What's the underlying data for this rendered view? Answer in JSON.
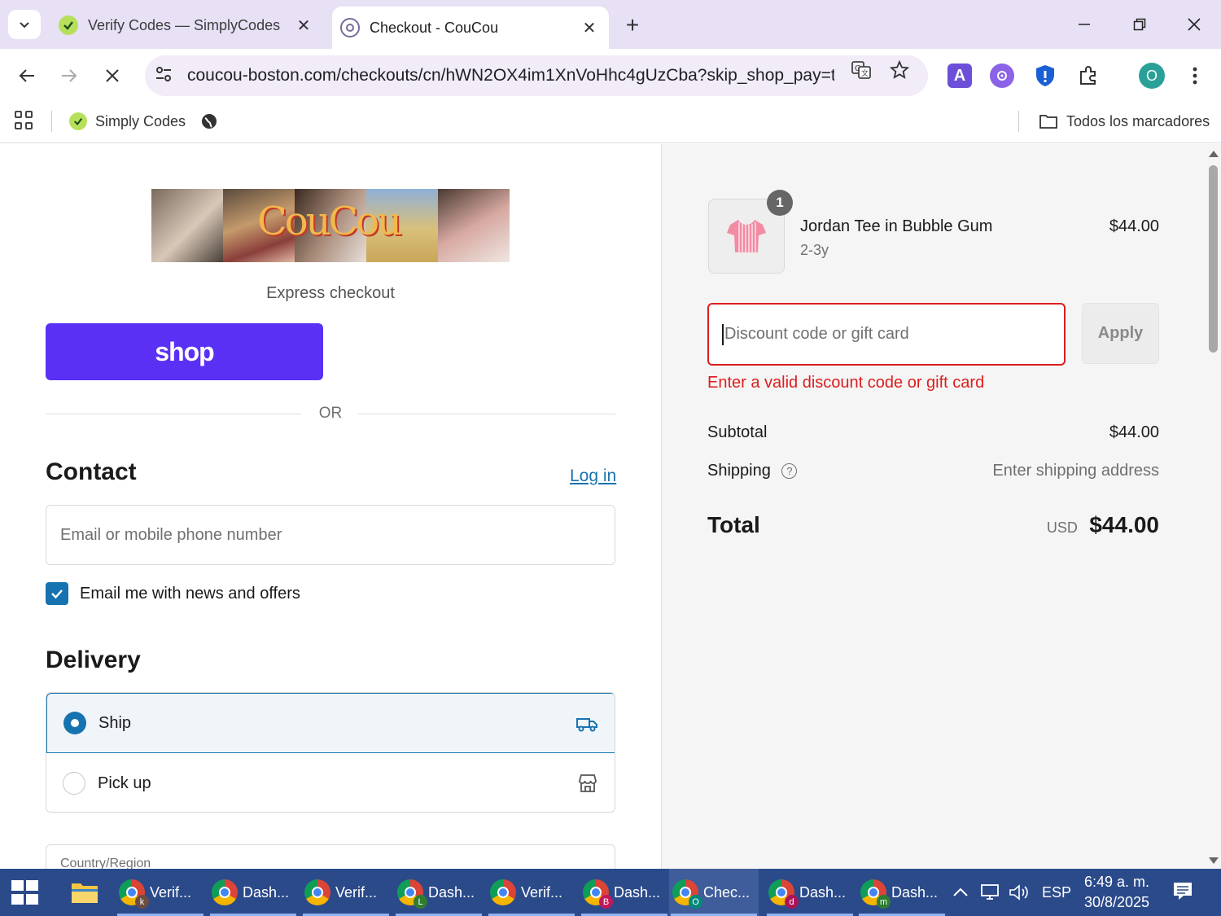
{
  "browser": {
    "tabs": [
      {
        "title": "Verify Codes — SimplyCodes",
        "favicon": "simplycodes-icon",
        "active": false
      },
      {
        "title": "Checkout - CouCou",
        "favicon": "coucou-icon",
        "active": true
      }
    ],
    "url": "coucou-boston.com/checkouts/cn/hWN2OX4im1XnVoHhc4gUzCba?skip_shop_pay=tr...",
    "bookmarks": [
      {
        "label": "Simply Codes",
        "icon": "simplycodes-icon"
      },
      {
        "label": "",
        "icon": "globe-icon"
      }
    ],
    "all_bookmarks_label": "Todos los marcadores",
    "profile_initial": "O"
  },
  "checkout": {
    "brand_logo_text": "CouCou",
    "express_checkout": "Express checkout",
    "shop_pay_label": "shop",
    "or_divider": "OR",
    "contact": {
      "heading": "Contact",
      "login_link": "Log in",
      "email_placeholder": "Email or mobile phone number",
      "newsletter_label": "Email me with news and offers",
      "newsletter_checked": true
    },
    "delivery": {
      "heading": "Delivery",
      "options": [
        {
          "label": "Ship",
          "selected": true,
          "icon": "truck-icon"
        },
        {
          "label": "Pick up",
          "selected": false,
          "icon": "store-icon"
        }
      ],
      "country_label": "Country/Region"
    }
  },
  "summary": {
    "item": {
      "name": "Jordan Tee in Bubble Gum",
      "variant": "2-3y",
      "price": "$44.00",
      "quantity": "1"
    },
    "discount": {
      "placeholder": "Discount code or gift card",
      "apply_label": "Apply",
      "error": "Enter a valid discount code or gift card"
    },
    "subtotal_label": "Subtotal",
    "subtotal_value": "$44.00",
    "shipping_label": "Shipping",
    "shipping_value": "Enter shipping address",
    "total_label": "Total",
    "total_currency": "USD",
    "total_value": "$44.00"
  },
  "taskbar": {
    "apps": [
      {
        "label": "Verif...",
        "badge": "k",
        "badge_color": "#6d4c41"
      },
      {
        "label": "Dash...",
        "badge": "",
        "badge_color": ""
      },
      {
        "label": "Verif...",
        "badge": "",
        "badge_color": ""
      },
      {
        "label": "Dash...",
        "badge": "L",
        "badge_color": "#2e7d32"
      },
      {
        "label": "Verif...",
        "badge": "",
        "badge_color": ""
      },
      {
        "label": "Dash...",
        "badge": "B",
        "badge_color": "#c2185b"
      },
      {
        "label": "Chec...",
        "badge": "O",
        "badge_color": "#00897b",
        "active": true
      },
      {
        "label": "Dash...",
        "badge": "d",
        "badge_color": "#ad1457"
      },
      {
        "label": "Dash...",
        "badge": "m",
        "badge_color": "#2e7d32"
      }
    ],
    "language": "ESP",
    "time": "6:49 a. m.",
    "date": "30/8/2025"
  },
  "colors": {
    "accent": "#1773b0",
    "shop_pay": "#5a31f4",
    "error": "#dd1d1d",
    "tabstrip": "#e8e0f5",
    "taskbar": "#2b4a8a"
  }
}
